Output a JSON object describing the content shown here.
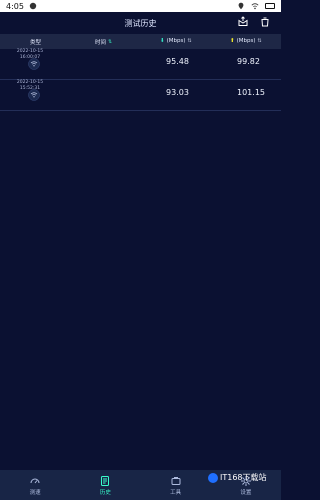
{
  "status": {
    "time": "4:05"
  },
  "header": {
    "title": "测试历史"
  },
  "table": {
    "headers": {
      "type": "类型",
      "time": "时间",
      "download": "(Mbps)",
      "upload": "(Mbps)"
    },
    "rows": [
      {
        "date": "2022-10-15",
        "clock": "16:00:07",
        "download": "95.48",
        "upload": "99.82"
      },
      {
        "date": "2022-10-15",
        "clock": "15:52:31",
        "download": "93.03",
        "upload": "101.15"
      }
    ]
  },
  "nav": {
    "items": [
      {
        "label": "测速"
      },
      {
        "label": "历史"
      },
      {
        "label": "工具"
      },
      {
        "label": "设置"
      }
    ]
  },
  "watermark": {
    "text": "IT168下载站"
  },
  "colors": {
    "bg": "#0b1132",
    "accent": "#39ffcc",
    "download_arrow": "#33e6c6",
    "upload_arrow": "#f2ea2a"
  }
}
